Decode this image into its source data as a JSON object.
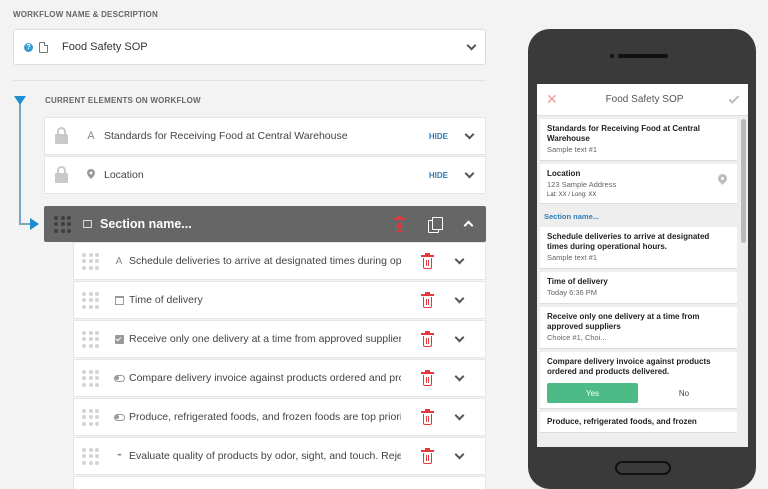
{
  "workflow": {
    "section_label": "WORKFLOW NAME & DESCRIPTION",
    "title": "Food Safety SOP"
  },
  "elements": {
    "section_label": "CURRENT ELEMENTS ON WORKFLOW",
    "fixed": [
      {
        "glyph": "A",
        "text": "Standards for Receiving Food at Central Warehouse",
        "action": "HIDE"
      },
      {
        "glyph": "pin",
        "text": "Location",
        "action": "HIDE"
      }
    ],
    "section": {
      "name": "Section name..."
    },
    "items": [
      {
        "icon": "text-icon",
        "glyph": "A",
        "text": "Schedule deliveries to arrive at designated times during ope"
      },
      {
        "icon": "calendar-icon",
        "glyph": "",
        "text": "Time of delivery"
      },
      {
        "icon": "checkbox-icon",
        "glyph": "",
        "text": "Receive only one delivery at a time from approved supplier:"
      },
      {
        "icon": "toggle-icon",
        "glyph": "",
        "text": "Compare delivery invoice against products ordered and pro"
      },
      {
        "icon": "toggle-icon",
        "glyph": "",
        "text": "Produce, refrigerated foods, and frozen foods are top priorit"
      },
      {
        "icon": "ellipsis-icon",
        "glyph": "•••",
        "text": "Evaluate quality of products by odor, sight, and touch. Rejec"
      }
    ]
  },
  "preview": {
    "title": "Food Safety SOP",
    "close_glyph": "✕",
    "cards": {
      "standards": {
        "title": "Standards for Receiving Food at Central Warehouse",
        "sub": "Sample text #1"
      },
      "location": {
        "title": "Location",
        "sub": "123 Sample Address",
        "coords": "Lat: XX / Long: XX"
      },
      "section": "Section name...",
      "schedule": {
        "title": "Schedule deliveries to arrive at designated times during operational hours.",
        "sub": "Sample text #1"
      },
      "time": {
        "title": "Time of delivery",
        "sub": "Today 6:36 PM"
      },
      "receive": {
        "title": "Receive only one delivery at a time from approved suppliers",
        "sub": "Choice #1, Choi..."
      },
      "compare": {
        "title": "Compare delivery invoice against products ordered and products delivered.",
        "yes": "Yes",
        "no": "No"
      },
      "produce": {
        "title": "Produce, refrigerated foods, and frozen"
      }
    }
  },
  "colors": {
    "accent": "#1d8fd0",
    "delete": "#e4383b",
    "yes": "#4cbb86",
    "section_bar": "#666666"
  }
}
